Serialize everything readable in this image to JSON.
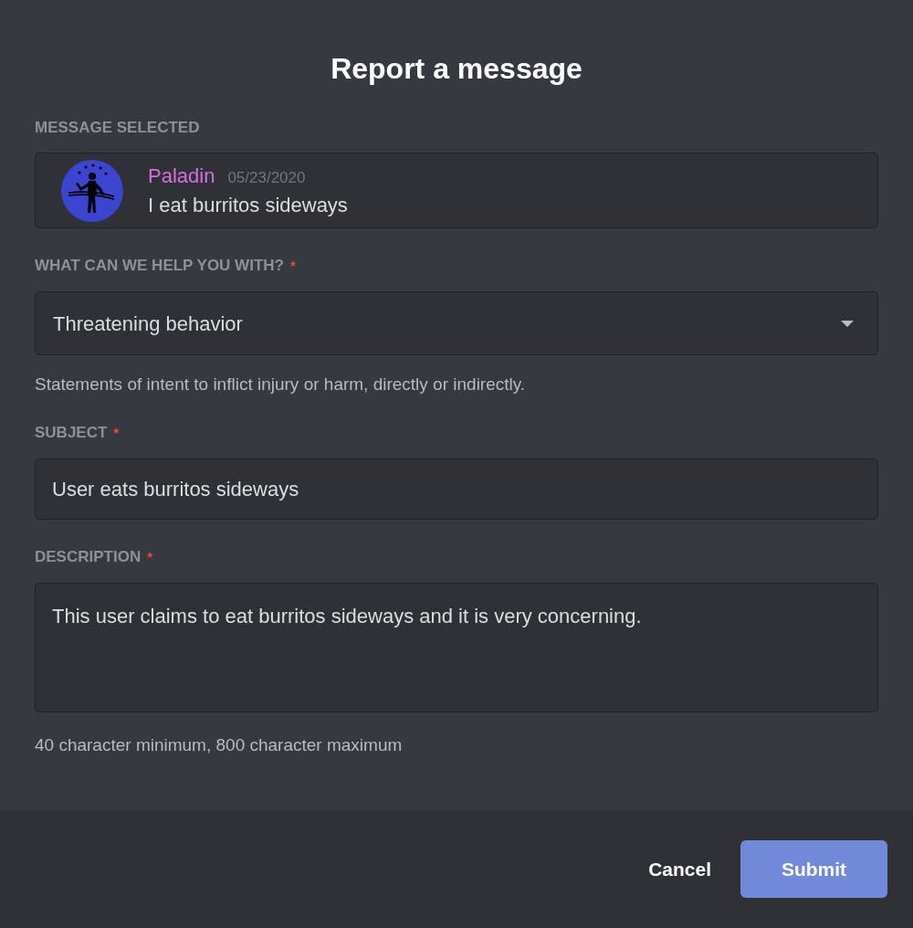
{
  "modal": {
    "title": "Report a message"
  },
  "message_selected": {
    "label": "MESSAGE SELECTED",
    "author": "Paladin",
    "timestamp": "05/23/2020",
    "content": "I eat burritos sideways"
  },
  "fields": [
    {
      "kind": "select",
      "label": "WHAT CAN WE HELP YOU WITH?",
      "required_mark": "*",
      "value": "Threatening behavior",
      "help": "Statements of intent to inflict injury or harm, directly or indirectly."
    },
    {
      "kind": "input",
      "label": "SUBJECT",
      "required_mark": "*",
      "value": "User eats burritos sideways"
    },
    {
      "kind": "textarea",
      "label": "DESCRIPTION",
      "required_mark": "*",
      "value": "This user claims to eat burritos sideways and it is very concerning.",
      "help": "40 character minimum, 800 character maximum"
    }
  ],
  "footer": {
    "buttons": [
      {
        "kind": "link",
        "label": "Cancel"
      },
      {
        "kind": "primary",
        "label": "Submit"
      }
    ]
  }
}
